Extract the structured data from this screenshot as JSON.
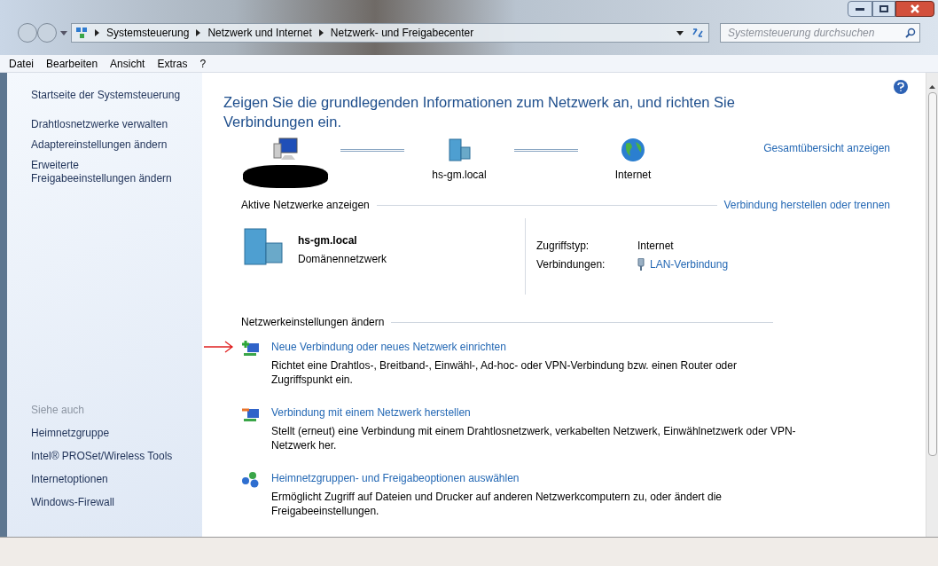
{
  "address": {
    "crumbs": [
      "Systemsteuerung",
      "Netzwerk und Internet",
      "Netzwerk- und Freigabecenter"
    ],
    "search": {
      "placeholder": "Systemsteuerung durchsuchen"
    }
  },
  "menu": [
    "Datei",
    "Bearbeiten",
    "Ansicht",
    "Extras",
    "?"
  ],
  "sidebar": {
    "links": [
      "Startseite der Systemsteuerung",
      "Drahtlosnetzwerke verwalten",
      "Adaptereinstellungen ändern",
      "Erweiterte Freigabeeinstellungen ändern"
    ],
    "see_also": {
      "heading": "Siehe auch",
      "links": [
        "Heimnetzgruppe",
        "Intel® PROSet/Wireless Tools",
        "Internetoptionen",
        "Windows-Firewall"
      ]
    }
  },
  "content": {
    "title": "Zeigen Sie die grundlegenden Informationen zum Netzwerk an, und richten Sie Verbindungen ein.",
    "map": {
      "nodes": [
        {
          "kind": "computer",
          "redacted": true
        },
        {
          "kind": "domain",
          "label": "hs-gm.local"
        },
        {
          "kind": "internet",
          "label": "Internet"
        }
      ],
      "overview_link": "Gesamtübersicht anzeigen"
    },
    "active": {
      "heading": "Aktive Netzwerke anzeigen",
      "link": "Verbindung herstellen oder trennen",
      "network": {
        "name": "hs-gm.local",
        "type": "Domänennetzwerk"
      },
      "access_label": "Zugriffstyp:",
      "access_value": "Internet",
      "connections_label": "Verbindungen:",
      "connection": "LAN-Verbindung"
    },
    "settings": {
      "heading": "Netzwerkeinstellungen ändern",
      "tasks": [
        {
          "kind": "new",
          "title": "Neue Verbindung oder neues Netzwerk einrichten",
          "description": "Richtet eine Drahtlos-, Breitband-, Einwähl-, Ad-hoc- oder VPN-Verbindung bzw. einen Router oder Zugriffspunkt ein.",
          "marked": true
        },
        {
          "kind": "connect",
          "title": "Verbindung mit einem Netzwerk herstellen",
          "description": "Stellt (erneut) eine Verbindung mit einem Drahtlosnetzwerk, verkabelten Netzwerk, Einwählnetzwerk oder VPN-Netzwerk her.",
          "marked": false
        },
        {
          "kind": "homegroup",
          "title": "Heimnetzgruppen- und Freigabeoptionen auswählen",
          "description": "Ermöglicht Zugriff auf Dateien und Drucker auf anderen Netzwerkcomputern zu, oder ändert die Freigabeeinstellungen.",
          "marked": false
        }
      ]
    }
  }
}
